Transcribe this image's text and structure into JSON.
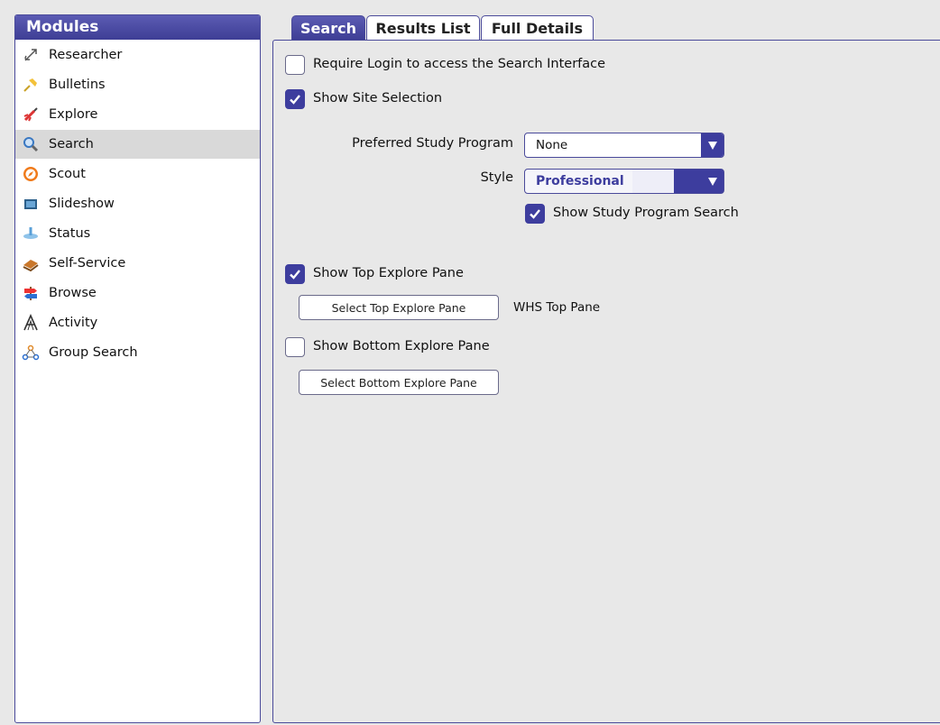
{
  "sidebar": {
    "title": "Modules",
    "items": [
      {
        "label": "Researcher",
        "icon": "researcher-icon"
      },
      {
        "label": "Bulletins",
        "icon": "pin-icon"
      },
      {
        "label": "Explore",
        "icon": "rocket-icon"
      },
      {
        "label": "Search",
        "icon": "magnifier-icon",
        "selected": true
      },
      {
        "label": "Scout",
        "icon": "compass-icon"
      },
      {
        "label": "Slideshow",
        "icon": "slideshow-icon"
      },
      {
        "label": "Status",
        "icon": "status-icon"
      },
      {
        "label": "Self-Service",
        "icon": "books-icon"
      },
      {
        "label": "Browse",
        "icon": "signpost-icon"
      },
      {
        "label": "Activity",
        "icon": "activity-icon"
      },
      {
        "label": "Group Search",
        "icon": "group-icon"
      }
    ]
  },
  "tabs": [
    {
      "label": "Search",
      "active": true
    },
    {
      "label": "Results List",
      "active": false
    },
    {
      "label": "Full Details",
      "active": false
    }
  ],
  "settings": {
    "require_login": {
      "label": "Require Login to access the Search Interface",
      "checked": false
    },
    "show_site_selection": {
      "label": "Show Site Selection",
      "checked": true
    },
    "preferred_study_program": {
      "label": "Preferred Study Program",
      "value": "None"
    },
    "style": {
      "label": "Style",
      "value": "Professional"
    },
    "show_study_program_search": {
      "label": "Show Study Program Search",
      "checked": true
    },
    "show_top_explore_pane": {
      "label": "Show Top Explore Pane",
      "checked": true
    },
    "select_top_explore_pane": {
      "label": "Select Top Explore Pane",
      "current": "WHS Top Pane"
    },
    "show_bottom_explore_pane": {
      "label": "Show Bottom Explore Pane",
      "checked": false
    },
    "select_bottom_explore_pane": {
      "label": "Select Bottom Explore Pane"
    }
  },
  "colors": {
    "accent": "#3d3d9e",
    "header": "#4a4aa6",
    "selected_row": "#d9d9d9"
  }
}
